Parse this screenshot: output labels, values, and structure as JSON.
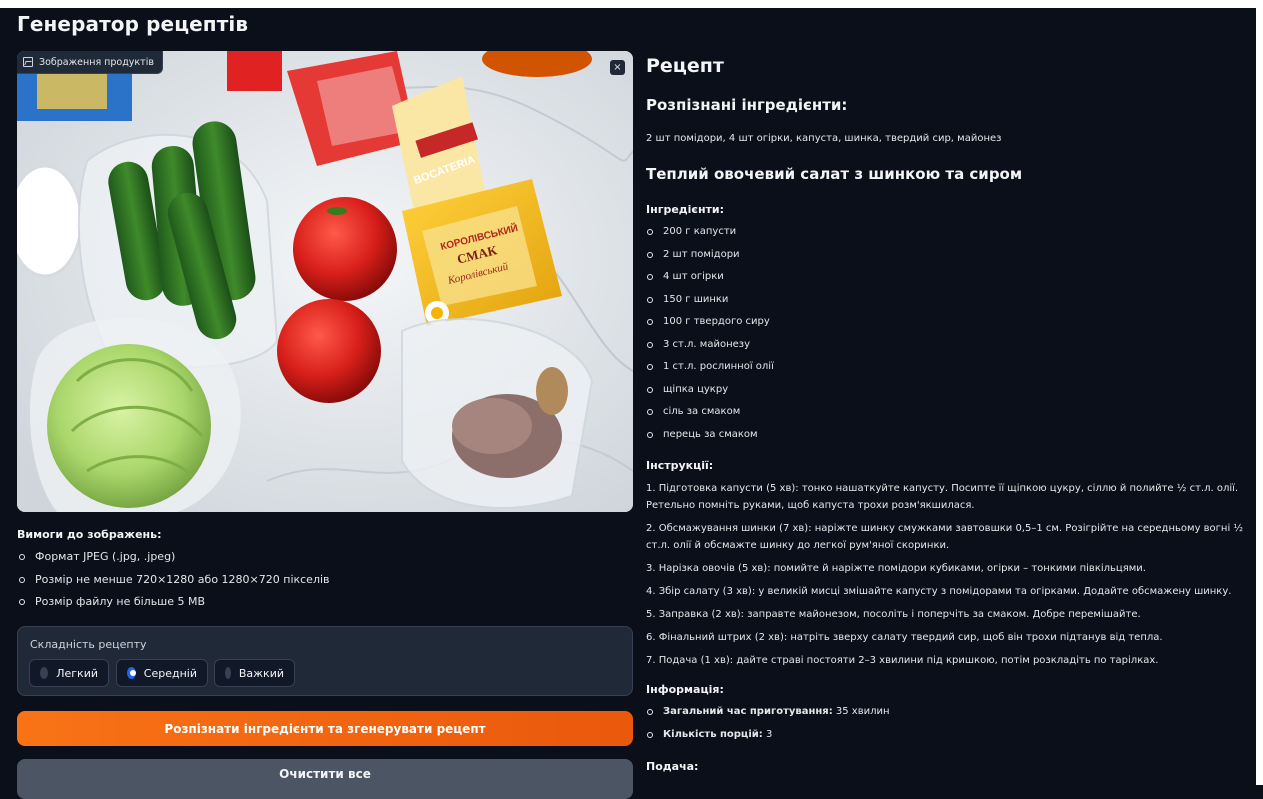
{
  "app": {
    "title": "Генератор рецептів"
  },
  "image_panel": {
    "label": "Зображення продуктів",
    "close_glyph": "×"
  },
  "requirements": {
    "title": "Вимоги до зображень:",
    "items": [
      "Формат JPEG (.jpg, .jpeg)",
      "Розмір не менше 720×1280 або 1280×720 пікселів",
      "Розмір файлу не більше 5 MB"
    ]
  },
  "difficulty": {
    "label": "Складність рецепту",
    "options": [
      "Легкий",
      "Середній",
      "Важкий"
    ],
    "selected": "Середній"
  },
  "buttons": {
    "generate": "Розпізнати інгредієнти та згенерувати рецепт",
    "clear": "Очистити все"
  },
  "recipe": {
    "heading": "Рецепт",
    "recognized_heading": "Розпізнані інгредієнти:",
    "recognized_text": "2 шт помідори, 4 шт огірки, капуста, шинка, твердий сир, майонез",
    "dish_title": "Теплий овочевий салат з шинкою та сиром",
    "ingredients_heading": "Інгредієнти:",
    "ingredients": [
      "200 г капусти",
      "2 шт помідори",
      "4 шт огірки",
      "150 г шинки",
      "100 г твердого сиру",
      "3 ст.л. майонезу",
      "1 ст.л. рослинної олії",
      "щіпка цукру",
      "сіль за смаком",
      "перець за смаком"
    ],
    "instructions_heading": "Інструкції:",
    "instructions": [
      "1. Підготовка капусти (5 хв): тонко нашаткуйте капусту. Посипте її щіпкою цукру, сіллю й полийте ½ ст.л. олії. Ретельно помніть руками, щоб капуста трохи розм'якшилася.",
      "2. Обсмажування шинки (7 хв): наріжте шинку смужками завтовшки 0,5–1 см. Розігрійте на середньому вогні ½ ст.л. олії й обсмажте шинку до легкої рум'яної скоринки.",
      "3. Нарізка овочів (5 хв): помийте й наріжте помідори кубиками, огірки – тонкими півкільцями.",
      "4. Збір салату (3 хв): у великій мисці змішайте капусту з помідорами та огірками. Додайте обсмажену шинку.",
      "5. Заправка (2 хв): заправте майонезом, посоліть і поперчіть за смаком. Добре перемішайте.",
      "6. Фінальний штрих (2 хв): натріть зверху салату твердий сир, щоб він трохи підтанув від тепла.",
      "7. Подача (1 хв): дайте страві постояти 2–3 хвилини під кришкою, потім розкладіть по тарілках."
    ],
    "info_heading": "Інформація:",
    "info": [
      {
        "label": "Загальний час приготування:",
        "value": " 35 хвилин"
      },
      {
        "label": "Кількість порцій:",
        "value": " 3"
      }
    ],
    "serving_heading": "Подача:"
  },
  "photo_text": {
    "package_brand": "КОРОЛІВСЬКИЙ",
    "package_word": "СМАК",
    "package_script": "Королівський",
    "box_text": "BOCATERIA"
  },
  "colors": {
    "background": "#0b0f19",
    "accent_orange": "#f97316",
    "radio_blue": "#2563eb",
    "panel": "#1f2937"
  }
}
